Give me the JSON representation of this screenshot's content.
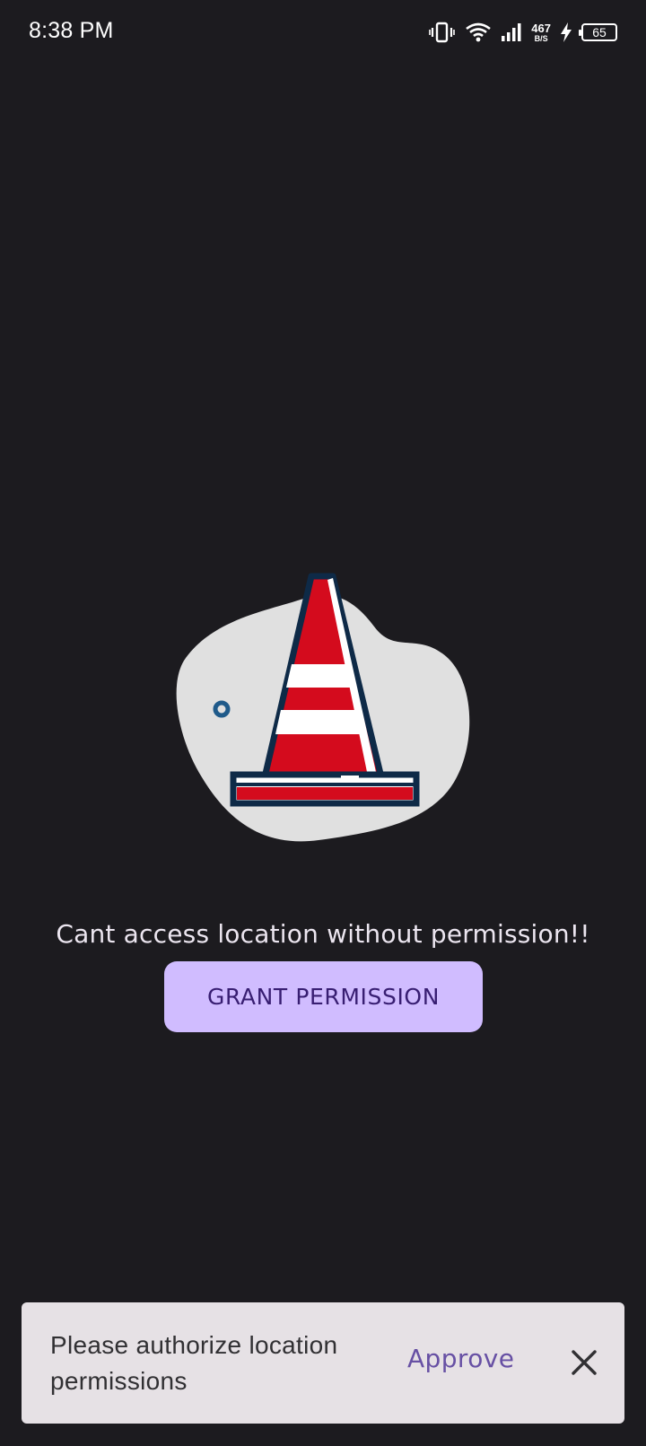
{
  "status_bar": {
    "time": "8:38 PM",
    "net_speed_value": "467",
    "net_speed_unit": "B/S",
    "battery_level": "65",
    "icons": [
      "vibrate-icon",
      "wifi-icon",
      "cellular-signal-icon",
      "charging-icon",
      "battery-icon"
    ]
  },
  "illustration": {
    "icon": "traffic-cone-icon",
    "colors": {
      "blob": "#e0e0e0",
      "cone_red": "#d40b1d",
      "cone_white": "#ffffff",
      "outline": "#0e2a47",
      "dot": "#1f5a8a"
    }
  },
  "main": {
    "message": "Cant access location without permission!!",
    "grant_button_label": "GRANT PERMISSION"
  },
  "snackbar": {
    "text": "Please authorize location permissions",
    "action_label": "Approve",
    "close_icon": "close-icon"
  },
  "colors": {
    "background": "#1c1b1f",
    "button_bg": "#d0bcff",
    "button_text": "#381e72",
    "snackbar_bg": "#e6e1e5",
    "snackbar_action": "#6750a4"
  }
}
